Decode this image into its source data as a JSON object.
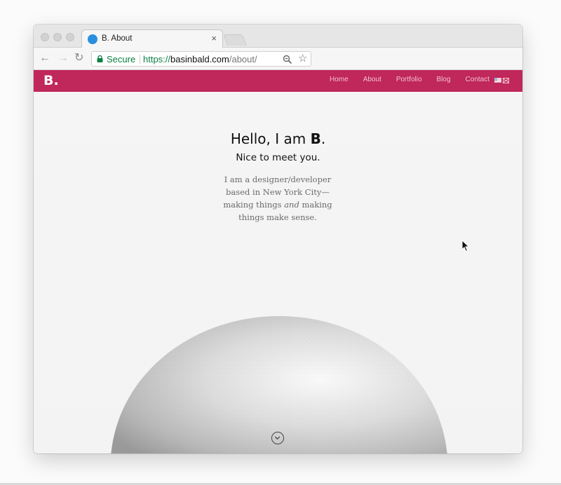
{
  "browser": {
    "tab_title": "B. About",
    "tab_close": "×",
    "nav": {
      "back": "←",
      "forward": "→",
      "reload": "↻"
    },
    "omnibox": {
      "secure_label": "Secure",
      "url_scheme": "https://",
      "url_host": "basinbald.com",
      "url_path": "/about/"
    },
    "bookmark_icon": "☆"
  },
  "site": {
    "logo": "B.",
    "brand_color": "#c0275a",
    "menu": [
      "Home",
      "About",
      "Portfolio",
      "Blog",
      "Contact"
    ],
    "hero": {
      "hello_prefix": "Hello, I am ",
      "hello_name": "B",
      "hello_suffix": ".",
      "subtitle": "Nice to meet you.",
      "bio_line1": "I am a designer/developer",
      "bio_line2": "based in New York City—",
      "bio_line3_a": "making things ",
      "bio_line3_em": "and",
      "bio_line3_b": " making",
      "bio_line4": "things make sense."
    },
    "icons": [
      "flag-icon",
      "envelope-icon",
      "chevron-down-icon"
    ]
  }
}
